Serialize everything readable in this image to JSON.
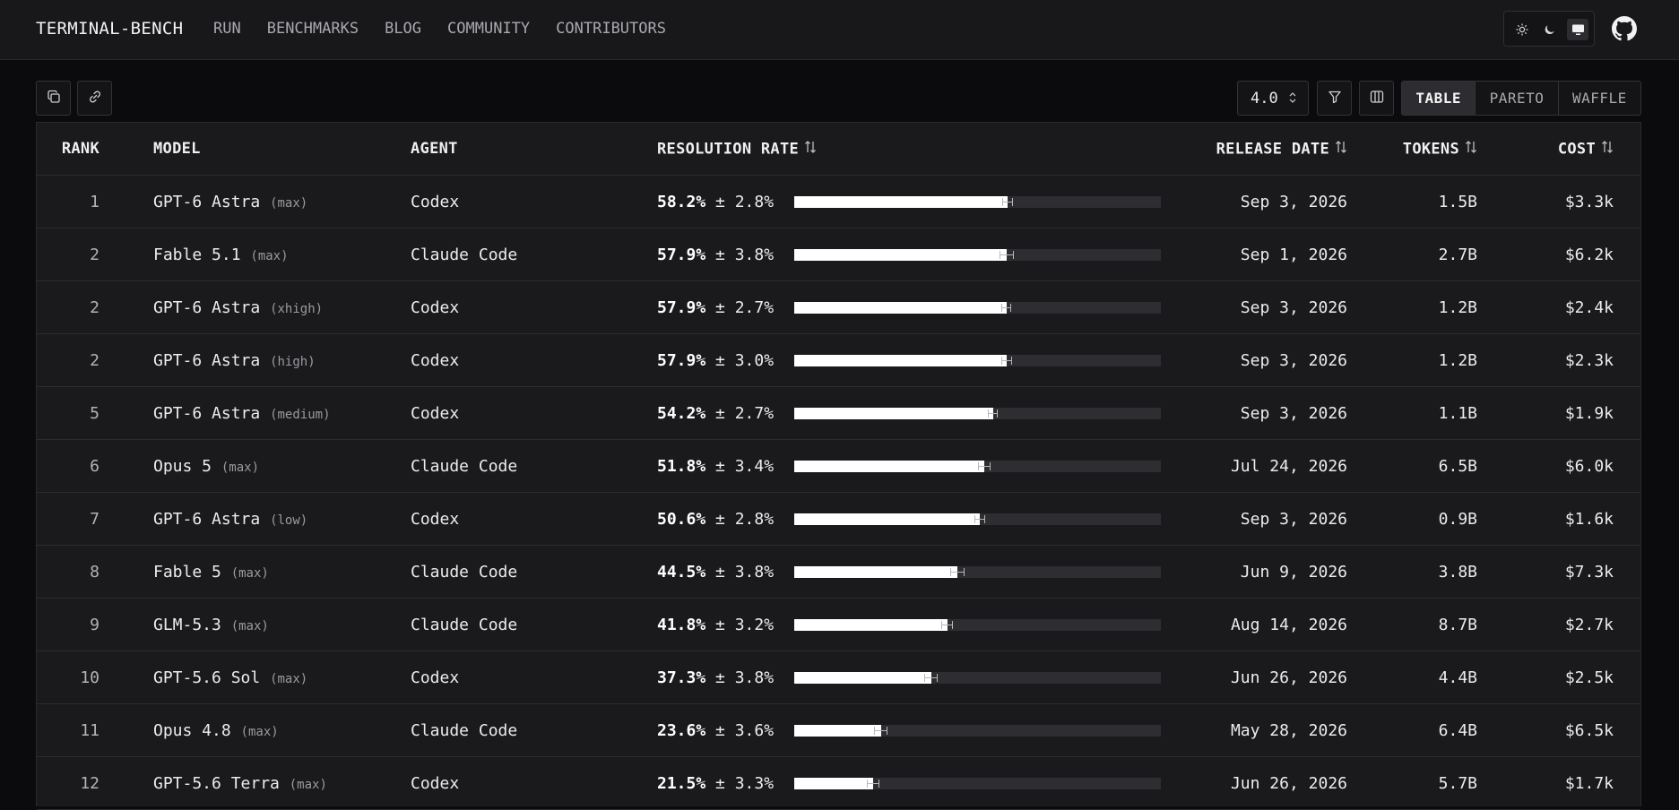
{
  "nav": {
    "brand": "TERMINAL-BENCH",
    "links": [
      "RUN",
      "BENCHMARKS",
      "BLOG",
      "COMMUNITY",
      "CONTRIBUTORS"
    ],
    "theme_icons": [
      "sun-icon",
      "moon-icon",
      "monitor-icon"
    ],
    "active_theme": "monitor",
    "github_icon": "github-icon"
  },
  "toolbar": {
    "version": "4.0",
    "views": [
      "TABLE",
      "PARETO",
      "WAFFLE"
    ],
    "active_view": "TABLE"
  },
  "table": {
    "headers": {
      "rank": "RANK",
      "model": "MODEL",
      "agent": "AGENT",
      "rate": "RESOLUTION RATE",
      "date": "RELEASE DATE",
      "tokens": "TOKENS",
      "cost": "COST"
    },
    "rows": [
      {
        "rank": "1",
        "model": "GPT-6 Astra",
        "effort": "(max)",
        "agent": "Codex",
        "rate": "58.2%",
        "err": "± 2.8%",
        "rate_value": 58.2,
        "err_value": 2.8,
        "date": "Sep 3, 2026",
        "tokens": "1.5B",
        "cost": "$3.3k"
      },
      {
        "rank": "2",
        "model": "Fable 5.1",
        "effort": "(max)",
        "agent": "Claude Code",
        "rate": "57.9%",
        "err": "± 3.8%",
        "rate_value": 57.9,
        "err_value": 3.8,
        "date": "Sep 1, 2026",
        "tokens": "2.7B",
        "cost": "$6.2k"
      },
      {
        "rank": "2",
        "model": "GPT-6 Astra",
        "effort": "(xhigh)",
        "agent": "Codex",
        "rate": "57.9%",
        "err": "± 2.7%",
        "rate_value": 57.9,
        "err_value": 2.7,
        "date": "Sep 3, 2026",
        "tokens": "1.2B",
        "cost": "$2.4k"
      },
      {
        "rank": "2",
        "model": "GPT-6 Astra",
        "effort": "(high)",
        "agent": "Codex",
        "rate": "57.9%",
        "err": "± 3.0%",
        "rate_value": 57.9,
        "err_value": 3.0,
        "date": "Sep 3, 2026",
        "tokens": "1.2B",
        "cost": "$2.3k"
      },
      {
        "rank": "5",
        "model": "GPT-6 Astra",
        "effort": "(medium)",
        "agent": "Codex",
        "rate": "54.2%",
        "err": "± 2.7%",
        "rate_value": 54.2,
        "err_value": 2.7,
        "date": "Sep 3, 2026",
        "tokens": "1.1B",
        "cost": "$1.9k"
      },
      {
        "rank": "6",
        "model": "Opus 5",
        "effort": "(max)",
        "agent": "Claude Code",
        "rate": "51.8%",
        "err": "± 3.4%",
        "rate_value": 51.8,
        "err_value": 3.4,
        "date": "Jul 24, 2026",
        "tokens": "6.5B",
        "cost": "$6.0k"
      },
      {
        "rank": "7",
        "model": "GPT-6 Astra",
        "effort": "(low)",
        "agent": "Codex",
        "rate": "50.6%",
        "err": "± 2.8%",
        "rate_value": 50.6,
        "err_value": 2.8,
        "date": "Sep 3, 2026",
        "tokens": "0.9B",
        "cost": "$1.6k"
      },
      {
        "rank": "8",
        "model": "Fable 5",
        "effort": "(max)",
        "agent": "Claude Code",
        "rate": "44.5%",
        "err": "± 3.8%",
        "rate_value": 44.5,
        "err_value": 3.8,
        "date": "Jun 9, 2026",
        "tokens": "3.8B",
        "cost": "$7.3k"
      },
      {
        "rank": "9",
        "model": "GLM-5.3",
        "effort": "(max)",
        "agent": "Claude Code",
        "rate": "41.8%",
        "err": "± 3.2%",
        "rate_value": 41.8,
        "err_value": 3.2,
        "date": "Aug 14, 2026",
        "tokens": "8.7B",
        "cost": "$2.7k"
      },
      {
        "rank": "10",
        "model": "GPT-5.6 Sol",
        "effort": "(max)",
        "agent": "Codex",
        "rate": "37.3%",
        "err": "± 3.8%",
        "rate_value": 37.3,
        "err_value": 3.8,
        "date": "Jun 26, 2026",
        "tokens": "4.4B",
        "cost": "$2.5k"
      },
      {
        "rank": "11",
        "model": "Opus 4.8",
        "effort": "(max)",
        "agent": "Claude Code",
        "rate": "23.6%",
        "err": "± 3.6%",
        "rate_value": 23.6,
        "err_value": 3.6,
        "date": "May 28, 2026",
        "tokens": "6.4B",
        "cost": "$6.5k"
      },
      {
        "rank": "12",
        "model": "GPT-5.6 Terra",
        "effort": "(max)",
        "agent": "Codex",
        "rate": "21.5%",
        "err": "± 3.3%",
        "rate_value": 21.5,
        "err_value": 3.3,
        "date": "Jun 26, 2026",
        "tokens": "5.7B",
        "cost": "$1.7k"
      }
    ]
  }
}
